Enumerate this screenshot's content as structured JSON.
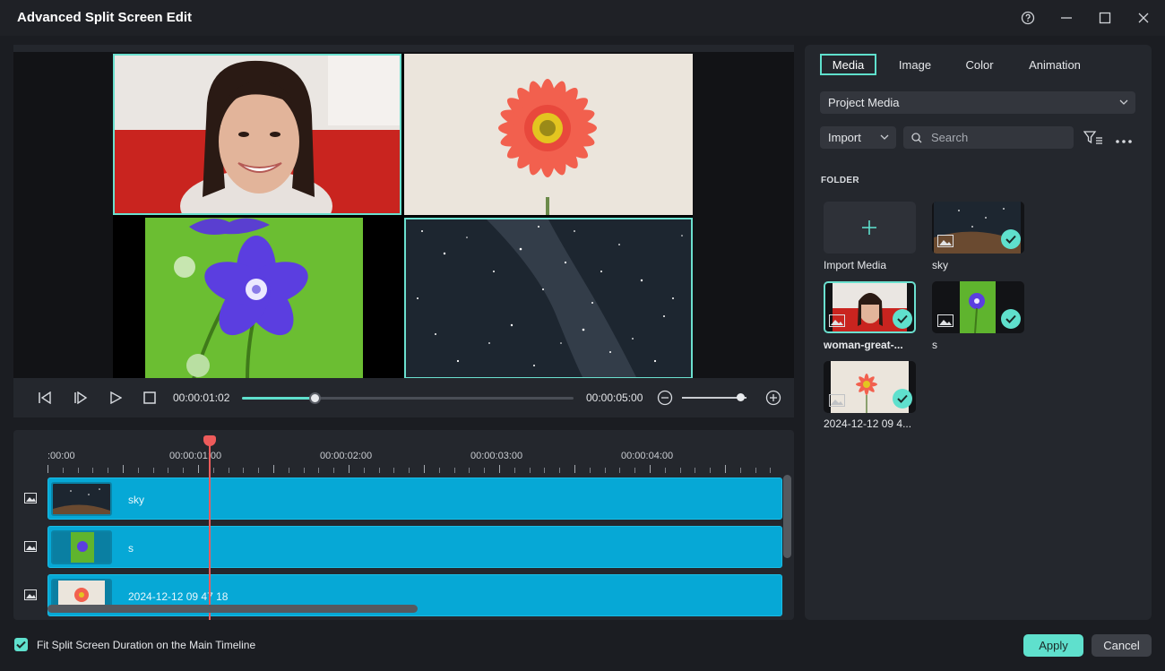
{
  "window": {
    "title": "Advanced Split Screen Edit",
    "icons": [
      "help-icon",
      "minimize-icon",
      "maximize-icon",
      "close-icon"
    ]
  },
  "player": {
    "current_time": "00:00:01:02",
    "total_time": "00:00:05:00",
    "progress": 0.22,
    "zoom_level": 0.9
  },
  "timeline": {
    "ruler_labels": [
      ":00:00",
      "00:00:01:00",
      "00:00:02:00",
      "00:00:03:00",
      "00:00:04:00"
    ],
    "tracks": [
      {
        "label": "sky"
      },
      {
        "label": "s"
      },
      {
        "label": "2024-12-12 09 47 18"
      }
    ]
  },
  "side": {
    "tabs": [
      "Media",
      "Image",
      "Color",
      "Animation"
    ],
    "active_tab": "Media",
    "source": "Project Media",
    "import_label": "Import",
    "search_placeholder": "Search",
    "folder_label": "FOLDER",
    "media": [
      {
        "name": "Import Media"
      },
      {
        "name": "sky"
      },
      {
        "name": "woman-great-..."
      },
      {
        "name": "s"
      },
      {
        "name": "2024-12-12 09 4..."
      }
    ]
  },
  "footer": {
    "fit_label": "Fit Split Screen Duration on the Main Timeline",
    "fit_checked": true,
    "apply": "Apply",
    "cancel": "Cancel"
  },
  "colors": {
    "accent": "#5fe0cd",
    "track": "#06a8d6",
    "playhead": "#ee5b5b"
  }
}
